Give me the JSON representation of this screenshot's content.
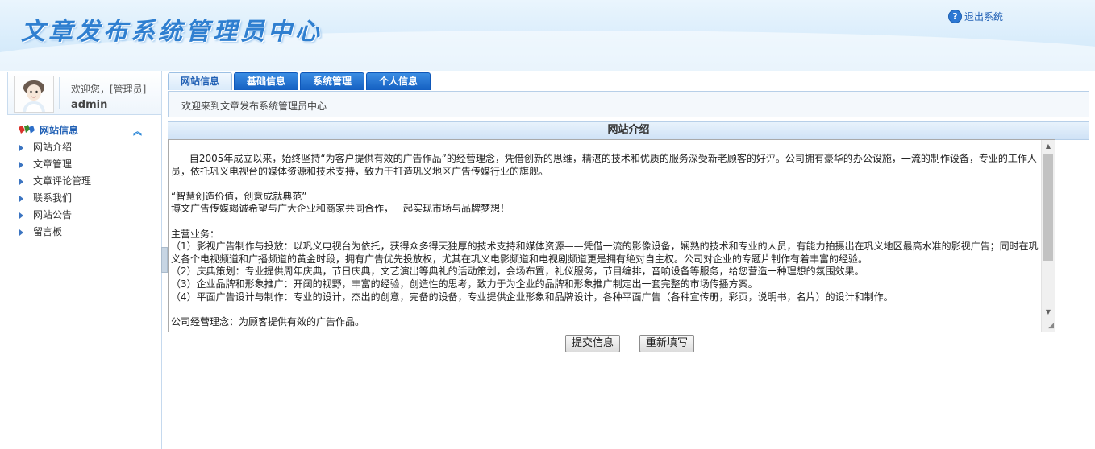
{
  "header": {
    "title": "文章发布系统管理员中心",
    "logout_label": "退出系统",
    "logout_icon": "help-icon"
  },
  "sidebar": {
    "welcome": "欢迎您，[管理员]",
    "username": "admin",
    "section_title": "网站信息",
    "items": [
      {
        "label": "网站介绍"
      },
      {
        "label": "文章管理"
      },
      {
        "label": "文章评论管理"
      },
      {
        "label": "联系我们"
      },
      {
        "label": "网站公告"
      },
      {
        "label": "留言板"
      }
    ]
  },
  "tabs": [
    {
      "label": "网站信息",
      "active": true
    },
    {
      "label": "基础信息",
      "active": false
    },
    {
      "label": "系统管理",
      "active": false
    },
    {
      "label": "个人信息",
      "active": false
    }
  ],
  "welcome_text": "欢迎来到文章发布系统管理员中心",
  "section_title": "网站介绍",
  "editor": {
    "content": "      自2005年成立以来，始终坚持“为客户提供有效的广告作品”的经营理念，凭借创新的思维，精湛的技术和优质的服务深受新老顾客的好评。公司拥有豪华的办公设施，一流的制作设备，专业的工作人员，依托巩义电视台的媒体资源和技术支持，致力于打造巩义地区广告传媒行业的旗舰。\n\n“智慧创造价值，创意成就典范”\n博文广告传媒竭诚希望与广大企业和商家共同合作，一起实现市场与品牌梦想！\n\n主营业务：\n（1）影视广告制作与投放：以巩义电视台为依托，获得众多得天独厚的技术支持和媒体资源——凭借一流的影像设备，娴熟的技术和专业的人员，有能力拍摄出在巩义地区最高水准的影视广告；同时在巩义各个电视频道和广播频道的黄金时段，拥有广告优先投放权，尤其在巩义电影频道和电视剧频道更是拥有绝对自主权。公司对企业的专题片制作有着丰富的经验。\n（2）庆典策划：专业提供周年庆典，节日庆典，文艺演出等典礼的活动策划，会场布置，礼仪服务，节目编排，音响设备等服务，给您营造一种理想的氛围效果。\n（3）企业品牌和形象推广：开阔的视野，丰富的经验，创造性的思考，致力于为企业的品牌和形象推广制定出一套完整的市场传播方案。\n（4）平面广告设计与制作：专业的设计，杰出的创意，完备的设备，专业提供企业形象和品牌设计，各种平面广告（各种宣传册，彩页，说明书，名片）的设计和制作。\n\n公司经营理念：为顾客提供有效的广告作品。"
  },
  "buttons": {
    "submit": "提交信息",
    "reset": "重新填写"
  },
  "colors": {
    "accent": "#1f5fb4",
    "tab_blue": "#145fc1",
    "header_bg": "#d8ecfb"
  }
}
